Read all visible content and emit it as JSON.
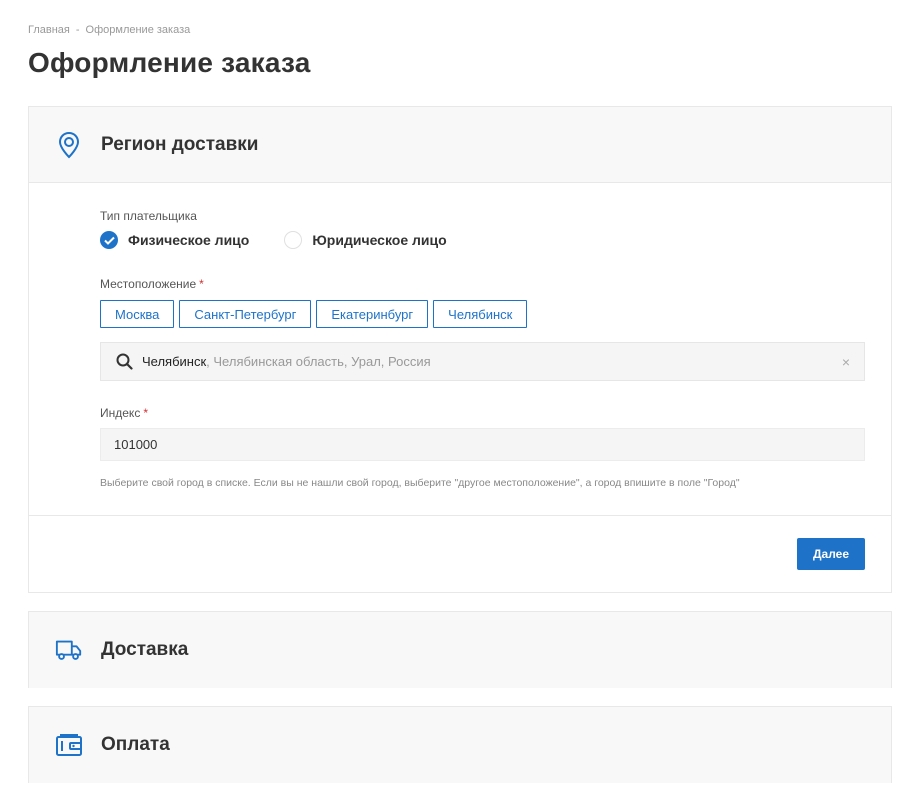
{
  "breadcrumb": {
    "home": "Главная",
    "separator": "-",
    "current": "Оформление заказа"
  },
  "page_title": "Оформление заказа",
  "colors": {
    "accent": "#1e73c9",
    "required": "#d32f2f",
    "header_bg": "#f8f8f8"
  },
  "region": {
    "title": "Регион доставки",
    "icon": "location-pin-icon",
    "payer_type_label": "Тип плательщика",
    "payer_options": [
      {
        "label": "Физическое лицо",
        "checked": true
      },
      {
        "label": "Юридическое лицо",
        "checked": false
      }
    ],
    "location_label": "Местоположение",
    "required_mark": "*",
    "cities": [
      "Москва",
      "Санкт-Петербург",
      "Екатеринбург",
      "Челябинск"
    ],
    "search": {
      "value": "Челябинск",
      "suffix": ", Челябинская область, Урал, Россия",
      "clear": "×"
    },
    "index_label": "Индекс",
    "index_value": "101000",
    "help_text": "Выберите свой город в списке. Если вы не нашли свой город, выберите \"другое местоположение\", а город впишите в поле \"Город\"",
    "next_button": "Далее"
  },
  "delivery": {
    "title": "Доставка",
    "icon": "truck-icon"
  },
  "payment": {
    "title": "Оплата",
    "icon": "wallet-icon"
  }
}
